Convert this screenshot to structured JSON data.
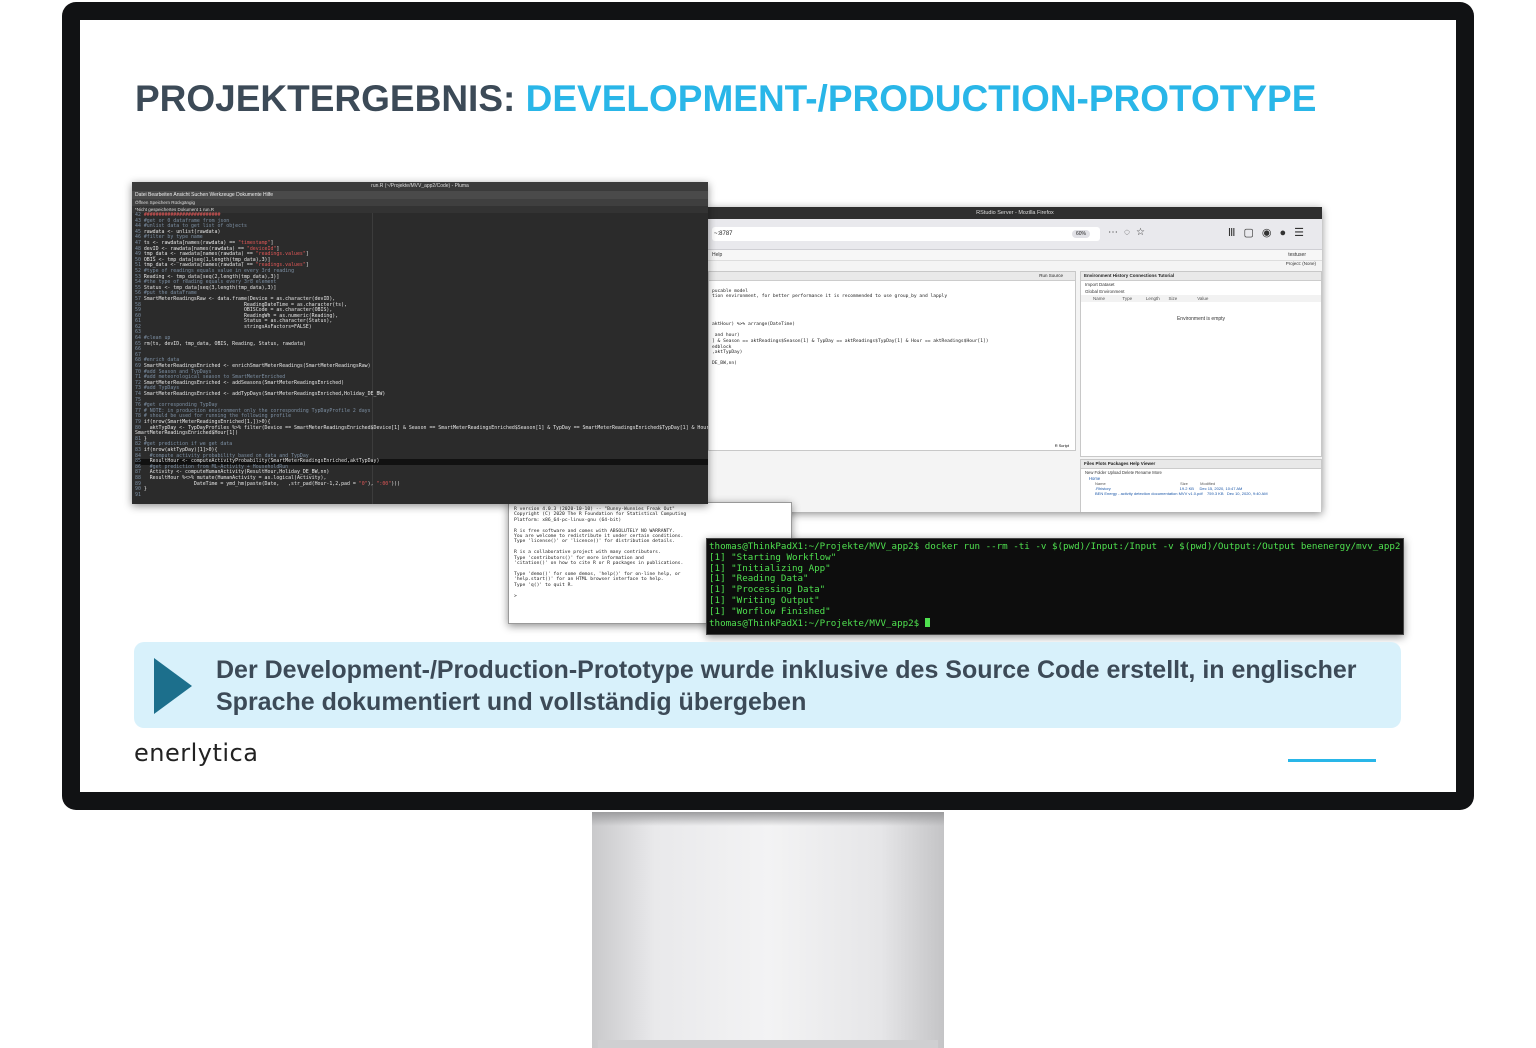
{
  "slide": {
    "title_prefix": "PROJEKTERGEBNIS: ",
    "title_highlight": "DEVELOPMENT-/PRODUCTION-PROTOTYPE",
    "callout_text": "Der Development-/Production-Prototype wurde inklusive des Source Code erstellt, in englischer Sprache dokumentiert und vollständig übergeben",
    "logo_text": "enerlytica"
  },
  "editor": {
    "title": "run.R (~/Projekte/MVV_app2/Code) - Pluma",
    "menu": "Datei  Bearbeiten  Ansicht  Suchen  Werkzeuge  Dokumente  Hilfe",
    "toolbar": "Öffnen  Speichern  Rückgängig",
    "tab": "*Nicht gespeichertes Dokument 1  run.R"
  },
  "rstudio": {
    "window_title": "RStudio Server - Mozilla Firefox",
    "url": "~:8787",
    "zoom": "60%",
    "menu_help": "Help",
    "user": "testuser",
    "project": "Project: (None)",
    "env_tabs": "Environment   History   Connections   Tutorial",
    "env_toolbar": "Import Dataset",
    "env_scope": "Global Environment",
    "env_columns": "Name              Type           Length       Size                Value",
    "env_empty": "Environment is empty",
    "files_tabs": "Files   Plots   Packages   Help   Viewer",
    "files_toolbar": "New Folder   Upload   Delete   Rename   More",
    "files_home": "Home",
    "files_columns": "Name                                                                   Size           Modified",
    "files_row1": ".Rhistory                                                              19.2 KB     Dec 15, 2020, 10:47 AM",
    "files_row2": "BEN Energy - activity detection documentation MVV v1.0.pdf    759.3 KB   Dec 10, 2020, 9:40 AM",
    "source_run": "Run     Source",
    "script_label": "R Script"
  },
  "console": {
    "lines": "R version 4.0.3 (2020-10-10) -- \"Bunny-Wunnies Freak Out\"\nCopyright (C) 2020 The R Foundation for Statistical Computing\nPlatform: x86_64-pc-linux-gnu (64-bit)\n\nR is free software and comes with ABSOLUTELY NO WARRANTY.\nYou are welcome to redistribute it under certain conditions.\nType 'license()' or 'licence()' for distribution details.\n\nR is a collaborative project with many contributors.\nType 'contributors()' for more information and\n'citation()' on how to cite R or R packages in publications.\n\nType 'demo()' for some demos, 'help()' for on-line help, or\n'help.start()' for an HTML browser interface to help.\nType 'q()' to quit R.\n\n>"
  },
  "terminal": {
    "command": "thomas@ThinkPadX1:~/Projekte/MVV_app2$ docker run --rm -ti -v $(pwd)/Input:/Input -v $(pwd)/Output:/Output benenergy/mvv_app2",
    "line1": "[1] \"Starting Workflow\"",
    "line2": "[1] \"Initializing App\"",
    "line3": "[1] \"Reading Data\"",
    "line4": "[1] \"Processing Data\"",
    "line5": "[1] \"Writing Output\"",
    "line6": "[1] \"Worflow Finished\"",
    "prompt": "thomas@ThinkPadX1:~/Projekte/MVV_app2$ "
  },
  "colors": {
    "title_dark": "#3c4a57",
    "title_accent": "#29b6e8",
    "callout_bg": "#d8f1fb",
    "arrow": "#1c6f8c",
    "terminal_text": "#4fe04f"
  }
}
